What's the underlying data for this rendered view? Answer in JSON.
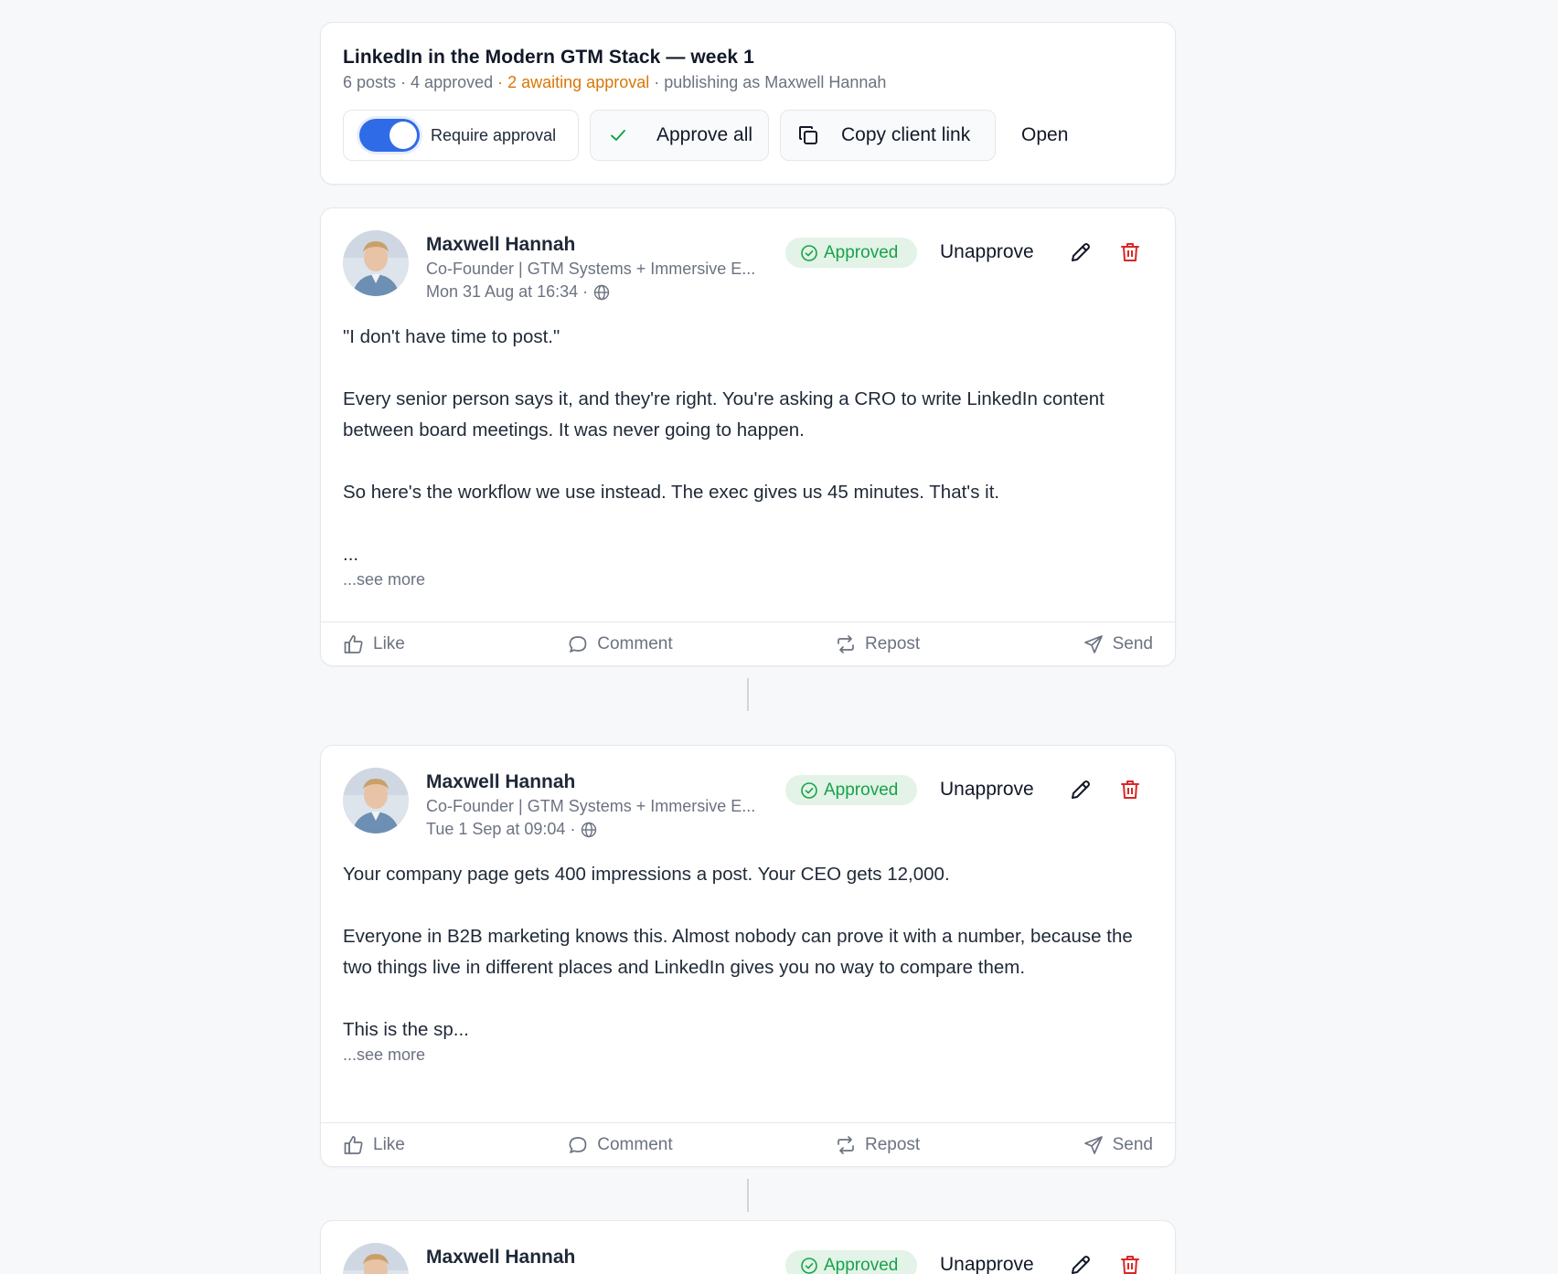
{
  "campaign": {
    "title": "LinkedIn in the Modern GTM Stack — week 1",
    "meta_posts": "6 posts",
    "meta_approved": "4 approved",
    "meta_awaiting": "2 awaiting approval",
    "meta_publishing": "publishing as Maxwell Hannah",
    "separator": " · ",
    "toggle_label": "Require approval",
    "toggle_on": true,
    "approve_all_label": "Approve all",
    "copy_link_label": "Copy client link",
    "open_label": "Open"
  },
  "post_actions": {
    "like": "Like",
    "comment": "Comment",
    "repost": "Repost",
    "send": "Send",
    "see_more": "...see more",
    "unapprove": "Unapprove"
  },
  "posts": [
    {
      "author": "Maxwell Hannah",
      "headline": "Co-Founder | GTM Systems + Immersive E...",
      "time": "Mon 31 Aug at 16:34 ·",
      "status": "Approved",
      "paragraphs": [
        "\"I don't have time to post.\"",
        "Every senior person says it, and they're right. You're asking a CRO to write LinkedIn content between board meetings. It was never going to happen.",
        "So here's the workflow we use instead. The exec gives us 45 minutes. That's it.",
        "..."
      ]
    },
    {
      "author": "Maxwell Hannah",
      "headline": "Co-Founder | GTM Systems + Immersive E...",
      "time": "Tue 1 Sep at 09:04 ·",
      "status": "Approved",
      "paragraphs": [
        "Your company page gets 400 impressions a post. Your CEO gets 12,000.",
        "Everyone in B2B marketing knows this. Almost nobody can prove it with a number, because the two things live in different places and LinkedIn gives you no way to compare them.",
        "This is the sp..."
      ]
    },
    {
      "author": "Maxwell Hannah",
      "headline": "",
      "time": "",
      "status": "Approved",
      "paragraphs": []
    }
  ],
  "colors": {
    "accent": "#2f6be6",
    "approved_bg": "#e3f3e7",
    "approved_text": "#16a34a",
    "warning": "#d97706",
    "delete": "#dc2626"
  }
}
